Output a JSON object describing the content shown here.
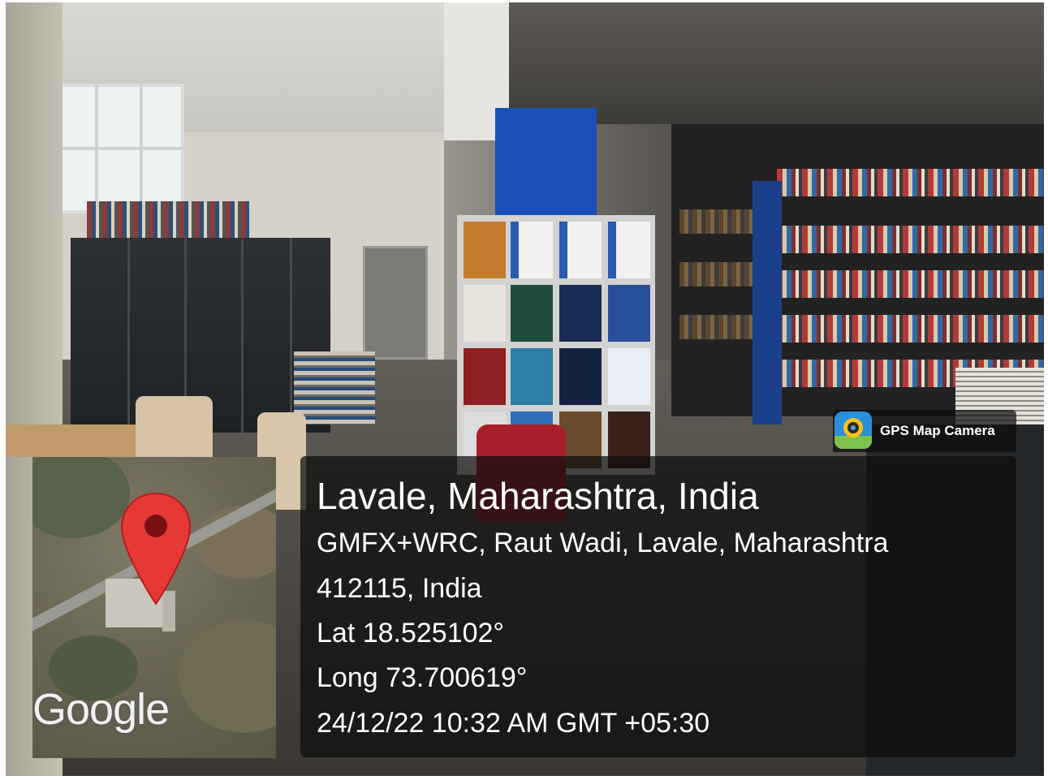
{
  "overlay": {
    "title": "Lavale, Maharashtra, India",
    "address_line1": "GMFX+WRC, Raut Wadi, Lavale, Maharashtra",
    "address_line2": "412115, India",
    "latitude": "Lat 18.525102°",
    "longitude": "Long 73.700619°",
    "timestamp": "24/12/22 10:32 AM GMT +05:30"
  },
  "brand": {
    "label": "GPS Map Camera",
    "icon": "gps-map-camera-app-icon"
  },
  "map": {
    "attribution": "Google",
    "marker_icon": "map-pin-icon",
    "marker_color": "#e53935"
  },
  "photo": {
    "icon": "library-interior-photo"
  }
}
